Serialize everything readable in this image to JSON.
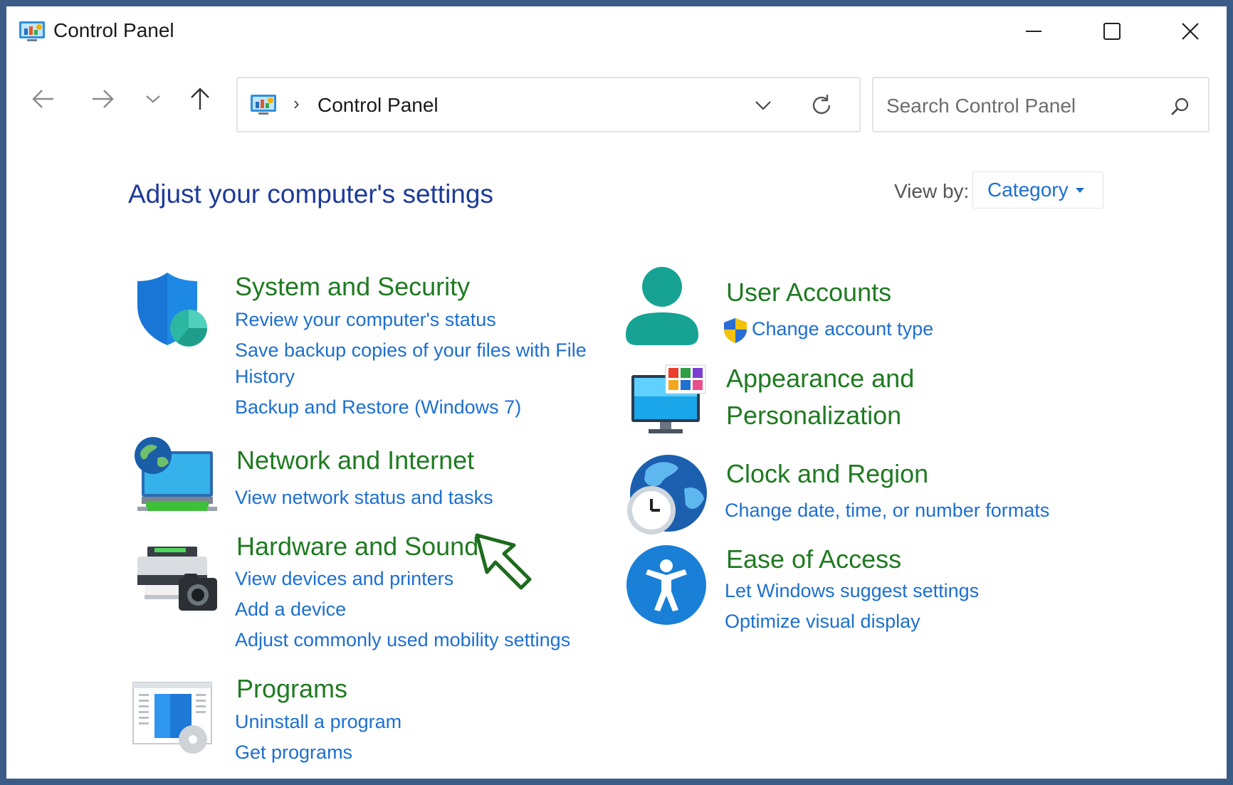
{
  "window": {
    "title": "Control Panel",
    "buttons": [
      "minimize-icon",
      "maximize-icon",
      "close-icon"
    ]
  },
  "nav": {
    "back_icon": "back-arrow-icon",
    "forward_icon": "forward-arrow-icon",
    "recent_icon": "chevron-down-icon",
    "up_icon": "up-arrow-icon"
  },
  "address": {
    "separator": "›",
    "path": "Control Panel"
  },
  "search": {
    "placeholder": "Search Control Panel"
  },
  "main": {
    "heading": "Adjust your computer's settings",
    "view_by": {
      "label": "View by:",
      "value": "Category"
    }
  },
  "categories": {
    "system_security": {
      "title": "System and Security",
      "links": [
        "Review your computer's status",
        "Save backup copies of your files with File",
        "History",
        "Backup and Restore (Windows 7)"
      ]
    },
    "network": {
      "title": "Network and Internet",
      "links": [
        "View network status and tasks"
      ]
    },
    "hardware": {
      "title": "Hardware and Sound",
      "links": [
        "View devices and printers",
        "Add a device",
        "Adjust commonly used mobility settings"
      ]
    },
    "programs": {
      "title": "Programs",
      "links": [
        "Uninstall a program",
        "Get programs"
      ]
    },
    "user_accounts": {
      "title": "User Accounts",
      "links": [
        "Change account type"
      ]
    },
    "appearance": {
      "title_line1": "Appearance and",
      "title_line2": "Personalization"
    },
    "clock": {
      "title": "Clock and Region",
      "links": [
        "Change date, time, or number formats"
      ]
    },
    "ease": {
      "title": "Ease of Access",
      "links": [
        "Let Windows suggest settings",
        "Optimize visual display"
      ]
    }
  },
  "colors": {
    "category_title": "#1f7a21",
    "link": "#1d6fd0",
    "heading": "#1e3a99",
    "annotation_arrow": "#1e6b1e",
    "frame": "#3b5c86"
  }
}
